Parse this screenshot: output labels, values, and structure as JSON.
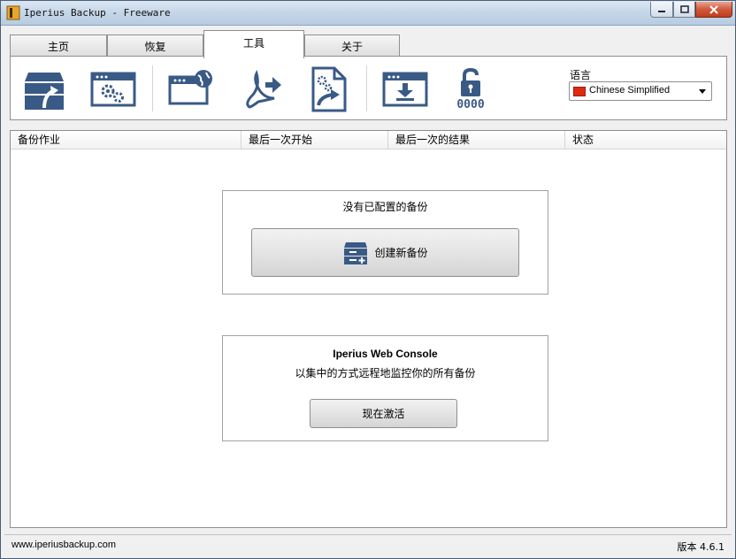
{
  "window": {
    "title": "Iperius Backup - Freeware"
  },
  "tabs": [
    {
      "label": "主页",
      "active": false
    },
    {
      "label": "恢复",
      "active": false
    },
    {
      "label": "工具",
      "active": true
    },
    {
      "label": "关于",
      "active": false
    }
  ],
  "toolbar": {
    "tools": [
      {
        "icon": "restore-archive-icon"
      },
      {
        "icon": "window-settings-icon"
      },
      {
        "icon": "window-globe-icon"
      },
      {
        "icon": "pdf-export-icon"
      },
      {
        "icon": "document-settings-export-icon"
      },
      {
        "icon": "window-download-icon"
      },
      {
        "icon": "lock-password-icon",
        "caption": "0000"
      }
    ],
    "language_label": "语言",
    "language_value": "Chinese Simplified"
  },
  "list": {
    "columns": [
      "备份作业",
      "最后一次开始",
      "最后一次的结果",
      "状态"
    ]
  },
  "empty_panel": {
    "message": "没有已配置的备份",
    "button_label": "创建新备份"
  },
  "web_console_panel": {
    "title": "Iperius Web Console",
    "subtitle": "以集中的方式远程地监控你的所有备份",
    "button_label": "现在激活"
  },
  "statusbar": {
    "website": "www.iperiusbackup.com",
    "version": "版本 4.6.1"
  },
  "colors": {
    "icon_blue": "#3a5a86",
    "panel_white": "#ffffff",
    "window_bg": "#f0f0f0"
  }
}
